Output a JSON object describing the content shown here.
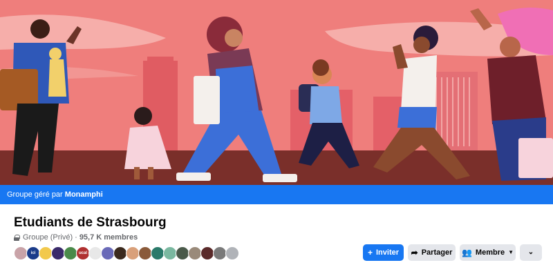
{
  "cover": {
    "image_description_icon": "group-cover-illustration-icon"
  },
  "managed_bar": {
    "prefix": "Groupe géré par",
    "admin": "Monamphi"
  },
  "group": {
    "title": "Etudiants de Strasbourg",
    "privacy": "Groupe (Privé)",
    "separator": "·",
    "member_count": "95,7 K membres"
  },
  "avatars": {
    "count": 18,
    "labels": [
      "",
      "ici",
      "",
      "",
      "",
      "ucal",
      "",
      "",
      "",
      "",
      "",
      "",
      "",
      "",
      "",
      "",
      "",
      ""
    ]
  },
  "actions": {
    "invite_label": "Inviter",
    "invite_icon": "plus-icon",
    "share_label": "Partager",
    "share_icon": "share-arrow-icon",
    "member_label": "Membre",
    "member_icon": "members-icon",
    "member_caret_icon": "caret-down-icon",
    "more_icon": "chevron-down-icon"
  },
  "colors": {
    "accent": "#1877f2",
    "cover_background": "#ef7e7c",
    "secondary_button": "#e4e6eb"
  }
}
